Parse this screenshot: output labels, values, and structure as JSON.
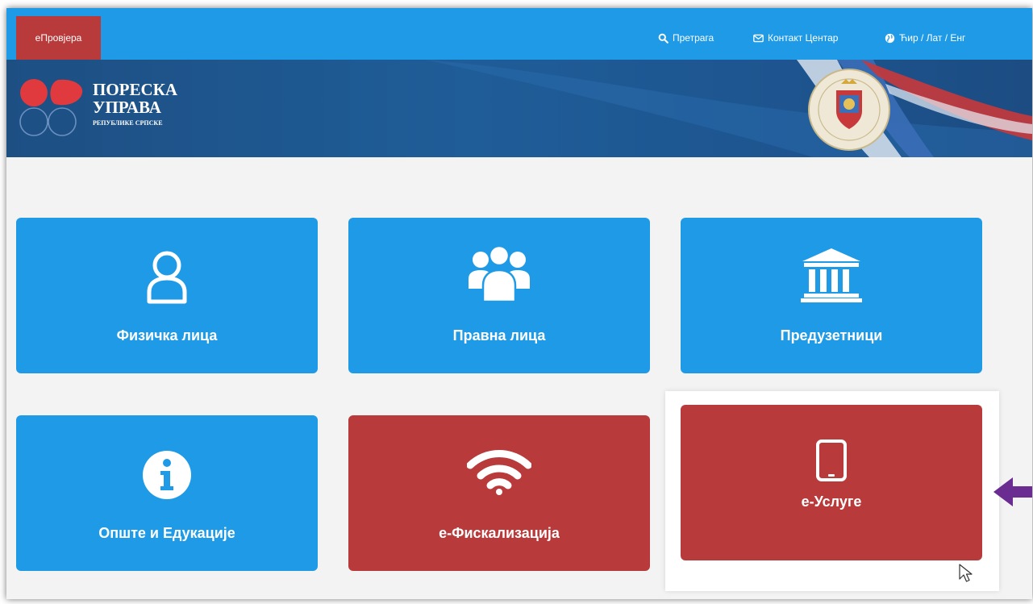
{
  "topbar": {
    "eprovjera_label": "еПровјера",
    "search_label": "Претрага",
    "contact_label": "Контакт Центар",
    "language_label": "Ћир / Лат / Енг"
  },
  "logo": {
    "line1": "ПОРЕСКА",
    "line2": "УПРАВА",
    "line3": "РЕПУБЛИКЕ СРПСКЕ"
  },
  "tiles": [
    {
      "label": "Физичка лица",
      "color": "blue",
      "icon": "user-icon"
    },
    {
      "label": "Правна лица",
      "color": "blue",
      "icon": "users-group-icon"
    },
    {
      "label": "Предузетници",
      "color": "blue",
      "icon": "bank-building-icon"
    },
    {
      "label": "Опште и Едукације",
      "color": "blue",
      "icon": "info-circle-icon"
    },
    {
      "label": "е-Фискализација",
      "color": "red",
      "icon": "wifi-icon"
    },
    {
      "label": "е-Услуге",
      "color": "red",
      "icon": "tablet-icon"
    }
  ],
  "colors": {
    "blue": "#1e9ae6",
    "red": "#b83a3b",
    "banner": "#1d4f83",
    "arrow": "#6a2c91"
  }
}
